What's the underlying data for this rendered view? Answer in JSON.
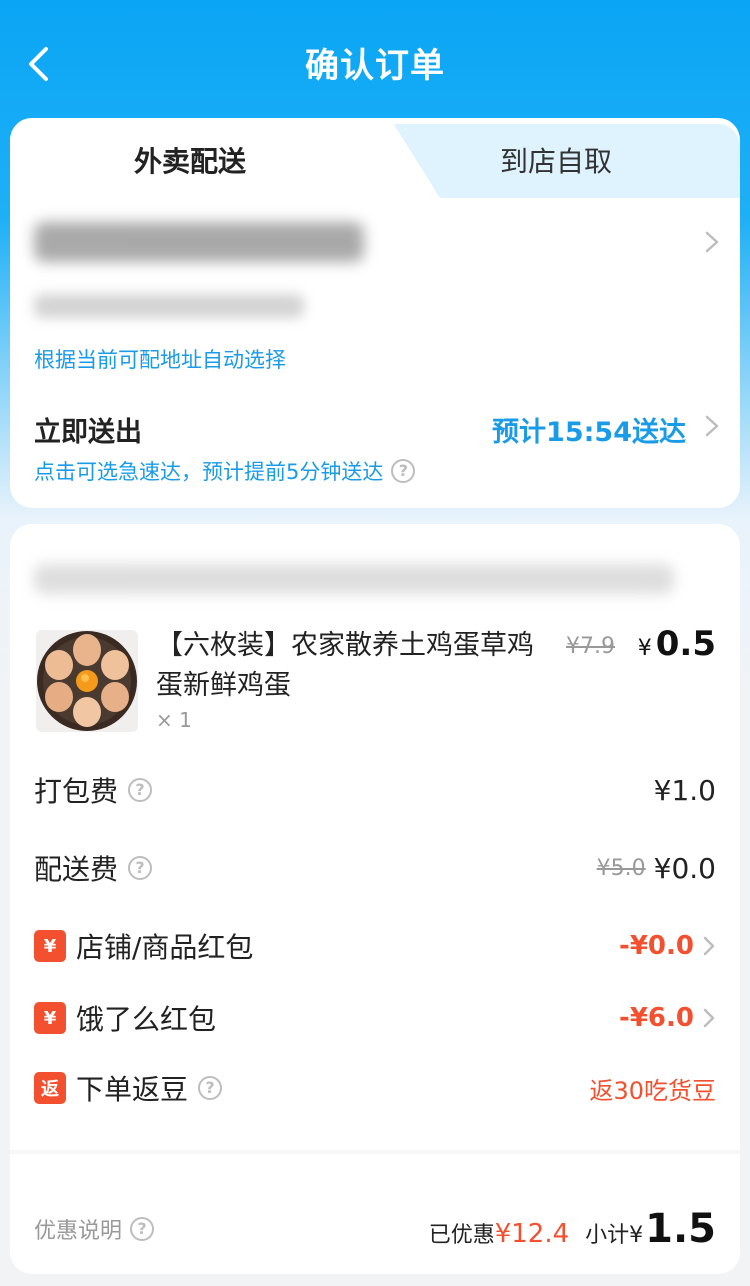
{
  "header": {
    "title": "确认订单"
  },
  "tabs": {
    "delivery": "外卖配送",
    "pickup": "到店自取"
  },
  "delivery": {
    "auto_select_note": "根据当前可配地址自动选择",
    "deliver_now": "立即送出",
    "eta": "预计15:54送达",
    "urgent_tip": "点击可选急速达，预计提前5分钟送达"
  },
  "product": {
    "name": "【六枚装】农家散养土鸡蛋草鸡蛋新鲜鸡蛋",
    "qty": "× 1",
    "orig_price": "¥7.9",
    "currency": "¥",
    "price": "0.5"
  },
  "fees": {
    "packing_label": "打包费",
    "packing_value": "¥1.0",
    "delivery_label": "配送费",
    "delivery_orig": "¥5.0",
    "delivery_value": "¥0.0",
    "shop_coupon_badge": "¥",
    "shop_coupon_label": "店铺/商品红包",
    "shop_coupon_value": "-¥0.0",
    "eleme_coupon_badge": "¥",
    "eleme_coupon_label": "饿了么红包",
    "eleme_coupon_value": "-¥6.0",
    "beans_badge": "返",
    "beans_label": "下单返豆",
    "beans_value": "返30吃货豆"
  },
  "summary": {
    "discount_note": "优惠说明",
    "saved_prefix": "已优惠",
    "saved_amount": "¥12.4",
    "subtotal_prefix": "小计¥",
    "subtotal_value": "1.5"
  },
  "icons": {
    "back": "chevron-left-icon",
    "chevron": "chevron-right-icon",
    "help": "question-circle-icon"
  },
  "colors": {
    "brand_blue": "#0aa5f5",
    "link_blue": "#1a9be8",
    "promo_red": "#f2502f"
  }
}
